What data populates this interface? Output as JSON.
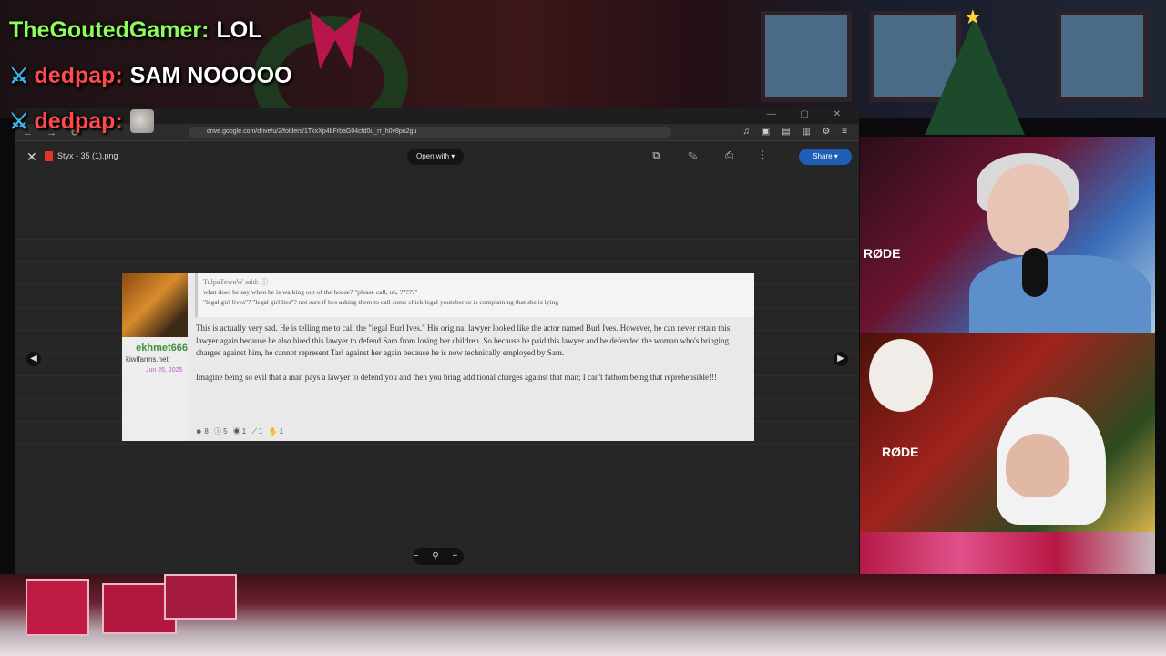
{
  "chat": [
    {
      "user": "TheGoutedGamer:",
      "message": "LOL",
      "badge": ""
    },
    {
      "user": "dedpap:",
      "message": "SAM NOOOOO",
      "badge": "sword-icon"
    },
    {
      "user": "dedpap:",
      "message": "",
      "badge": "sword-icon",
      "emote": "emote-image"
    }
  ],
  "browser": {
    "url": "drive.google.com/drive/u/2/folders/1TkxXp4bFrbaG04cfd0u_rr_h0v8pu2gu",
    "file_name": "Styx - 35 (1).png",
    "open_with_label": "Open with ▾",
    "share_label": "Share ▾"
  },
  "post": {
    "username": "ekhmet666",
    "site": "kiwifarms.net",
    "joined": "Jun 26, 2025",
    "quote_author": "TulpaTownW said: ⓘ",
    "quote_lines": [
      "what does he say when he is walking out of the house? \"please call, uh, ?????\"",
      "\"legal girl lives\"? \"legal girl lies\"? not sure if hes asking them to call some chick legal youtuber or is complaining that she is lying"
    ],
    "body": [
      "This is actually very sad. He is telling me to call the \"legal Burl Ives.\" His original lawyer looked like the actor named Burl Ives. However, he can never retain this lawyer again because he also hired this lawyer to defend Sam from losing her children. So because he paid this lawyer and he defended the woman who's bringing charges against him, he cannot represent Tarl against her again because he is now technically employed by Sam.",
      "Imagine being so evil that a man pays a lawyer to defend you and then you bring additional charges against that man; I can't fathom being that reprehensible!!!"
    ],
    "reactions": "☻8  ⓘ5  ◉1  ⟋1  ✋1"
  },
  "webcams": {
    "mic_label": "RØDE",
    "mic_label_2": "RØDE"
  },
  "colors": {
    "chat_user_green": "#8dfc5c",
    "chat_user_red": "#ff4a4a",
    "share_blue": "#1f5fb8",
    "username_green": "#3d8f3d"
  }
}
